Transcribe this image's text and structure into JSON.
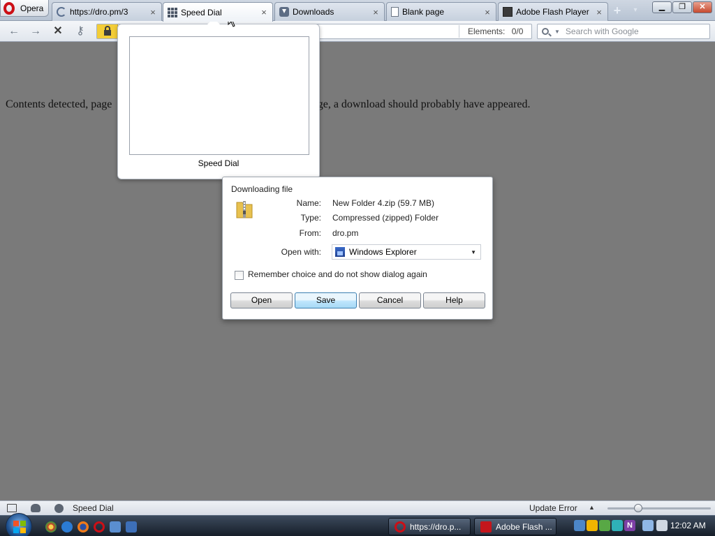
{
  "browser": {
    "menu_label": "Opera",
    "tabs": [
      {
        "label": "https://dro.pm/3",
        "icon": "loading-icon"
      },
      {
        "label": "Speed Dial",
        "icon": "speed-dial-icon"
      },
      {
        "label": "Downloads",
        "icon": "downloads-icon"
      },
      {
        "label": "Blank page",
        "icon": "page-icon"
      },
      {
        "label": "Adobe Flash Player ...",
        "icon": "flash-icon"
      }
    ],
    "tab_close": "×",
    "new_tab": "+",
    "tab_menu": "▾",
    "window_buttons": {
      "minimize": "▁",
      "restore": "❐",
      "close": "✕"
    }
  },
  "navbar": {
    "back": "←",
    "forward": "→",
    "stop": "✕",
    "key": "⚷",
    "elements_label": "Elements:",
    "elements_value": "0/0",
    "search_placeholder": "Search with Google"
  },
  "page": {
    "text_left": "Contents detected, page",
    "text_right": "sage, a download should probably have appeared."
  },
  "speed_dial_popup": {
    "caption": "Speed Dial"
  },
  "download_dialog": {
    "title": "Downloading file",
    "name_label": "Name:",
    "name_value": "New Folder 4.zip (59.7 MB)",
    "type_label": "Type:",
    "type_value": "Compressed (zipped) Folder",
    "from_label": "From:",
    "from_value": "dro.pm",
    "open_with_label": "Open with:",
    "open_with_value": "Windows Explorer",
    "remember_label": "Remember choice and do not show dialog again",
    "buttons": {
      "open": "Open",
      "save": "Save",
      "cancel": "Cancel",
      "help": "Help"
    }
  },
  "statusbar": {
    "title": "Speed Dial",
    "update_error": "Update Error",
    "zoom_fraction": 0.28
  },
  "taskbar": {
    "tasks": [
      {
        "label": "https://dro.p...",
        "color": "#cc0f16"
      },
      {
        "label": "Adobe Flash ...",
        "color": "#c4161c"
      }
    ],
    "clock": "12:02 AM"
  },
  "colors": {
    "page_background": "#7a7a7a",
    "opera_red": "#cc0f16",
    "lock_yellow": "#f3cd37",
    "default_button": "#bee6fd"
  }
}
